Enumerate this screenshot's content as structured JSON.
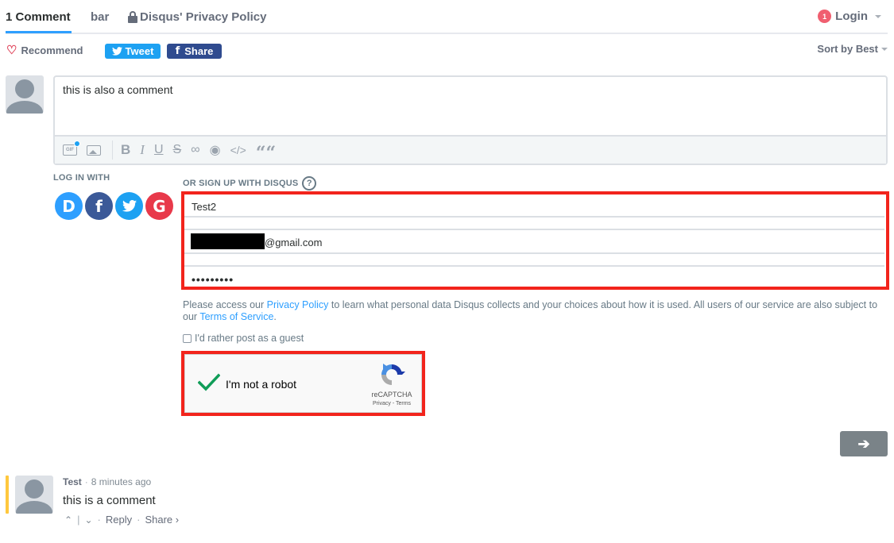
{
  "nav": {
    "tabs": [
      {
        "label": "1 Comment",
        "active": true
      },
      {
        "label": "bar",
        "active": false
      },
      {
        "label": "Disqus' Privacy Policy",
        "active": false,
        "icon": "lock-icon"
      }
    ],
    "login": {
      "label": "Login",
      "notification_count": "1"
    }
  },
  "actions": {
    "recommend_label": "Recommend",
    "tweet_label": "Tweet",
    "share_label": "Share",
    "sort_label": "Sort by Best"
  },
  "editor": {
    "text": "this is also a comment",
    "toolbar": [
      "gif-icon",
      "image-icon",
      "bold-icon",
      "italic-icon",
      "underline-icon",
      "strikethrough-icon",
      "link-icon",
      "spoiler-icon",
      "code-icon",
      "quote-icon"
    ],
    "glyphs": {
      "bold": "B",
      "italic": "I",
      "underline": "U",
      "strike": "S",
      "link": "∞",
      "spoiler": "◉",
      "code": "</>",
      "quote": "““",
      "gif": "GIF"
    }
  },
  "auth": {
    "login_with_label": "LOG IN WITH",
    "signup_label": "OR SIGN UP WITH DISQUS",
    "help_glyph": "?",
    "providers": [
      {
        "name": "Disqus",
        "glyph": "D",
        "color": "#2e9fff"
      },
      {
        "name": "Facebook",
        "glyph": "f",
        "color": "#3b5998"
      },
      {
        "name": "Twitter",
        "glyph": "✈",
        "color": "#1da1f2"
      },
      {
        "name": "Google",
        "glyph": "G",
        "color": "#e8394a"
      }
    ],
    "fields": {
      "name": "Test2",
      "email_suffix": "@gmail.com",
      "password": "•••••••••"
    },
    "legal_prefix": "Please access our ",
    "privacy_link": "Privacy Policy",
    "legal_middle": " to learn what personal data Disqus collects and your choices about how it is used. All users of our service are also subject to our ",
    "terms_link": "Terms of Service",
    "legal_suffix": ".",
    "guest_label": "I'd rather post as a guest",
    "guest_checked": false
  },
  "captcha": {
    "label": "I'm not a robot",
    "checked": true,
    "brand": "reCAPTCHA",
    "links": "Privacy - Terms"
  },
  "submit": {
    "glyph": "➔"
  },
  "comments": [
    {
      "author": "Test",
      "time": "8 minutes ago",
      "body": "this is a comment",
      "reply_label": "Reply",
      "share_label": "Share ›",
      "upvote_glyph": "⌃",
      "downvote_glyph": "⌄",
      "separator": "·"
    }
  ],
  "colors": {
    "accent": "#2e9fff",
    "highlight": "#f2241c",
    "tweet": "#1da1f2",
    "facebook": "#2f4b8f",
    "comment_marker": "#ffc83d"
  }
}
